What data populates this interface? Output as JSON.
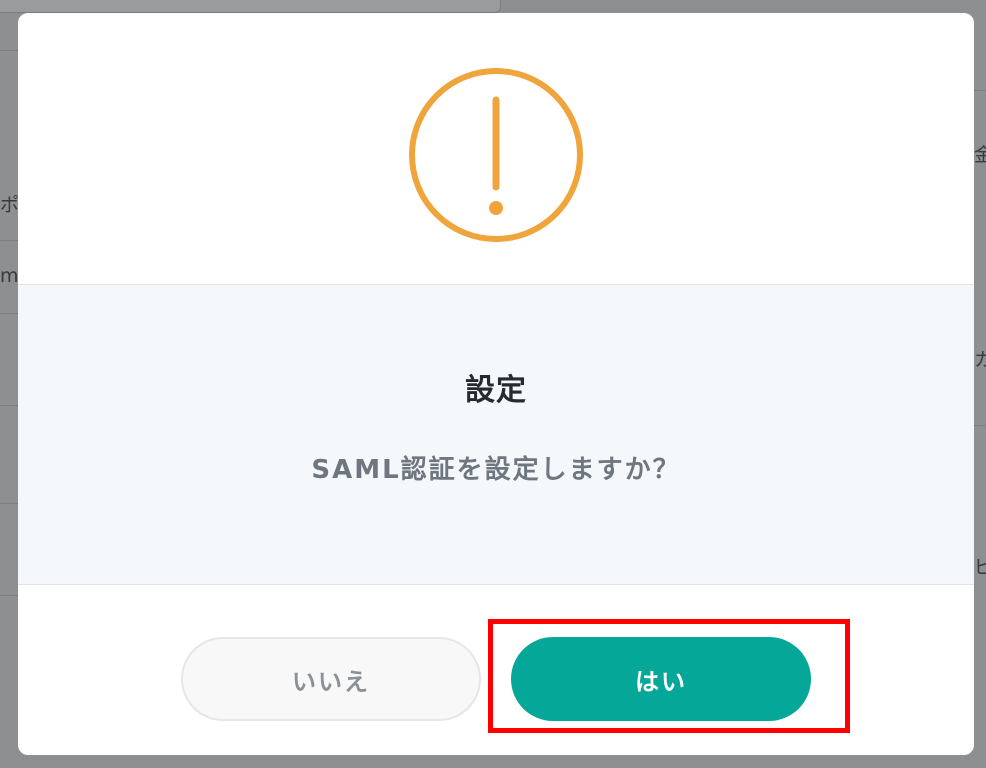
{
  "background": {
    "fragments": [
      "ポ",
      "m",
      "金",
      "カ",
      "ビ"
    ]
  },
  "dialog": {
    "icon": "exclamation-circle-icon",
    "icon_color": "#f0a43c",
    "title": "設定",
    "message": "SAML認証を設定しますか？",
    "buttons": {
      "no_label": "いいえ",
      "yes_label": "はい"
    },
    "accent_color": "#05a898",
    "highlight_color": "#ff0000"
  }
}
